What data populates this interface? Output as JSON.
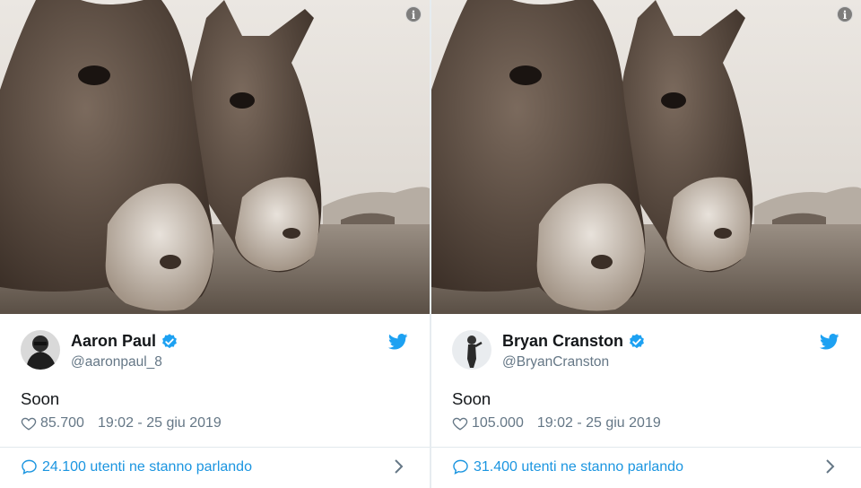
{
  "tweets": [
    {
      "name": "Aaron Paul",
      "handle": "@aaronpaul_8",
      "text": "Soon",
      "likes": "85.700",
      "timestamp": "19:02 - 25 giu 2019",
      "conversation": "24.100 utenti ne stanno parlando",
      "icons": [
        "info-icon",
        "verified-badge-icon",
        "twitter-bird-icon",
        "heart-icon",
        "comment-bubble-icon",
        "chevron-right-icon"
      ]
    },
    {
      "name": "Bryan Cranston",
      "handle": "@BryanCranston",
      "text": "Soon",
      "likes": "105.000",
      "timestamp": "19:02 - 25 giu 2019",
      "conversation": "31.400 utenti ne stanno parlando",
      "icons": [
        "info-icon",
        "verified-badge-icon",
        "twitter-bird-icon",
        "heart-icon",
        "comment-bubble-icon",
        "chevron-right-icon"
      ]
    }
  ],
  "colors": {
    "accent": "#1da1f2",
    "link": "#1b95e0",
    "secondary_text": "#657786",
    "divider": "#e1e8ed"
  }
}
